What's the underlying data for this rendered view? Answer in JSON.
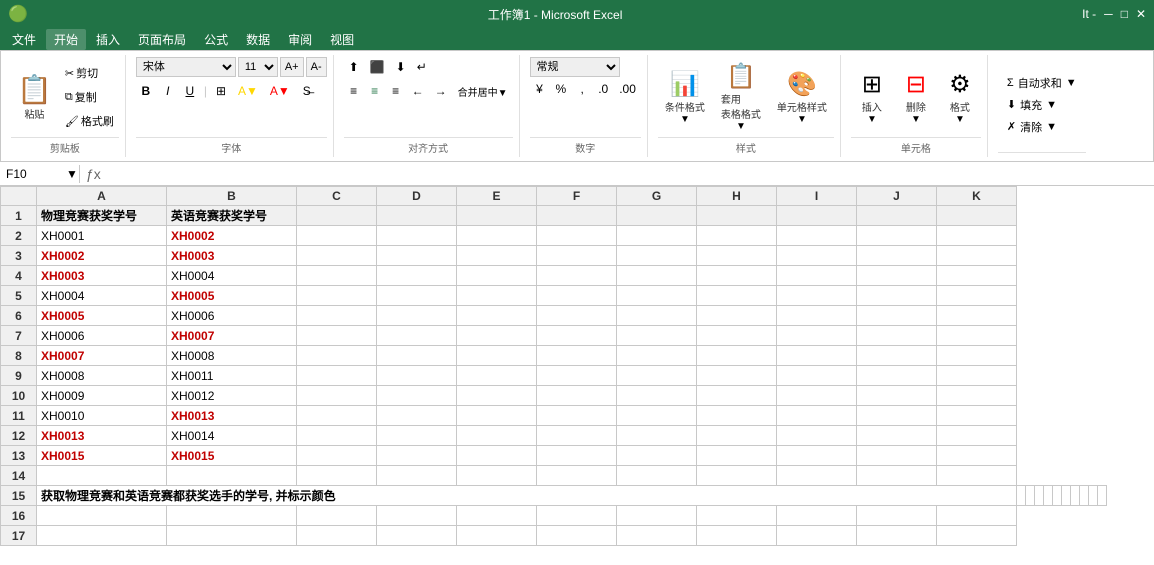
{
  "titleBar": {
    "title": "工作簿1 - Microsoft Excel",
    "windowControls": [
      "It -"
    ]
  },
  "menuBar": {
    "items": [
      "文件",
      "开始",
      "插入",
      "页面布局",
      "公式",
      "数据",
      "审阅",
      "视图"
    ]
  },
  "ribbon": {
    "activeTab": "开始",
    "groups": {
      "clipboard": {
        "label": "剪贴板",
        "buttons": [
          "粘贴",
          "剪切",
          "复制",
          "格式刷"
        ]
      },
      "font": {
        "label": "字体",
        "fontName": "宋体",
        "fontSize": "11",
        "bold": "B",
        "italic": "I",
        "underline": "U"
      },
      "alignment": {
        "label": "对齐方式"
      },
      "number": {
        "label": "数字",
        "format": "常规"
      },
      "styles": {
        "label": "样式",
        "buttons": [
          "条件格式",
          "套用表格格式",
          "单元格样式"
        ]
      },
      "cells": {
        "label": "单元格",
        "buttons": [
          "插入",
          "删除",
          "格式"
        ]
      },
      "editing": {
        "label": "",
        "buttons": [
          "自动求和",
          "填充",
          "清除"
        ]
      }
    }
  },
  "formulaBar": {
    "cellRef": "F10",
    "formula": ""
  },
  "columns": [
    "A",
    "B",
    "C",
    "D",
    "E",
    "F",
    "G",
    "H",
    "I",
    "J",
    "K"
  ],
  "rows": [
    {
      "num": 1,
      "cells": [
        "物理竞赛获奖学号",
        "英语竞赛获奖学号",
        "",
        "",
        "",
        "",
        "",
        "",
        "",
        "",
        ""
      ]
    },
    {
      "num": 2,
      "cells": [
        "XH0001",
        "XH0002",
        "",
        "",
        "",
        "",
        "",
        "",
        "",
        "",
        ""
      ]
    },
    {
      "num": 3,
      "cells": [
        "XH0002",
        "XH0003",
        "",
        "",
        "",
        "",
        "",
        "",
        "",
        "",
        ""
      ]
    },
    {
      "num": 4,
      "cells": [
        "XH0003",
        "XH0004",
        "",
        "",
        "",
        "",
        "",
        "",
        "",
        "",
        ""
      ]
    },
    {
      "num": 5,
      "cells": [
        "XH0004",
        "XH0005",
        "",
        "",
        "",
        "",
        "",
        "",
        "",
        "",
        ""
      ]
    },
    {
      "num": 6,
      "cells": [
        "XH0005",
        "XH0006",
        "",
        "",
        "",
        "",
        "",
        "",
        "",
        "",
        ""
      ]
    },
    {
      "num": 7,
      "cells": [
        "XH0006",
        "XH0007",
        "",
        "",
        "",
        "",
        "",
        "",
        "",
        "",
        ""
      ]
    },
    {
      "num": 8,
      "cells": [
        "XH0007",
        "XH0008",
        "",
        "",
        "",
        "",
        "",
        "",
        "",
        "",
        ""
      ]
    },
    {
      "num": 9,
      "cells": [
        "XH0008",
        "XH0011",
        "",
        "",
        "",
        "",
        "",
        "",
        "",
        "",
        ""
      ]
    },
    {
      "num": 10,
      "cells": [
        "XH0009",
        "XH0012",
        "",
        "",
        "",
        "",
        "",
        "",
        "",
        "",
        ""
      ]
    },
    {
      "num": 11,
      "cells": [
        "XH0010",
        "XH0013",
        "",
        "",
        "",
        "",
        "",
        "",
        "",
        "",
        ""
      ]
    },
    {
      "num": 12,
      "cells": [
        "XH0013",
        "XH0014",
        "",
        "",
        "",
        "",
        "",
        "",
        "",
        "",
        ""
      ]
    },
    {
      "num": 13,
      "cells": [
        "XH0015",
        "XH0015",
        "",
        "",
        "",
        "",
        "",
        "",
        "",
        "",
        ""
      ]
    },
    {
      "num": 14,
      "cells": [
        "",
        "",
        "",
        "",
        "",
        "",
        "",
        "",
        "",
        "",
        ""
      ]
    },
    {
      "num": 15,
      "cells": [
        "获取物理竞赛和英语竞赛都获奖选手的学号, 并标示颜色",
        "",
        "",
        "",
        "",
        "",
        "",
        "",
        "",
        "",
        ""
      ]
    },
    {
      "num": 16,
      "cells": [
        "",
        "",
        "",
        "",
        "",
        "",
        "",
        "",
        "",
        "",
        ""
      ]
    },
    {
      "num": 17,
      "cells": [
        "",
        "",
        "",
        "",
        "",
        "",
        "",
        "",
        "",
        "",
        ""
      ]
    }
  ],
  "highlightRows": [
    3,
    7,
    13
  ],
  "boldRow15": true
}
